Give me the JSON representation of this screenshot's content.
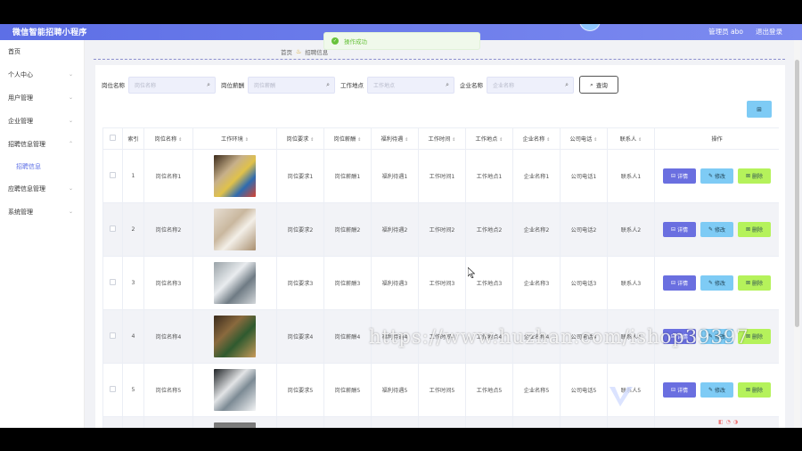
{
  "app": {
    "title": "微信智能招聘小程序"
  },
  "header": {
    "user_label": "管理员 abo",
    "logout_label": "退出登录"
  },
  "toast": {
    "message": "操作成功"
  },
  "sidebar": {
    "items": [
      {
        "label": "首页",
        "has_children": false
      },
      {
        "label": "个人中心",
        "has_children": true
      },
      {
        "label": "用户管理",
        "has_children": true
      },
      {
        "label": "企业管理",
        "has_children": true
      },
      {
        "label": "招聘信息管理",
        "has_children": true
      },
      {
        "label": "应聘信息管理",
        "has_children": true
      },
      {
        "label": "系统管理",
        "has_children": true
      }
    ],
    "sub_item": {
      "label": "招聘信息"
    }
  },
  "breadcrumb": {
    "home": "首页",
    "current": "招聘信息"
  },
  "search": {
    "fields": [
      {
        "label": "岗位名称",
        "placeholder": "岗位名称"
      },
      {
        "label": "岗位薪酬",
        "placeholder": "岗位薪酬"
      },
      {
        "label": "工作地点",
        "placeholder": "工作地点"
      },
      {
        "label": "企业名称",
        "placeholder": "企业名称"
      }
    ],
    "query_label": "查询"
  },
  "toolbar": {
    "add_label": "新增"
  },
  "table": {
    "headers": [
      "索引",
      "岗位名称",
      "工作环境",
      "岗位要求",
      "岗位薪酬",
      "福利待遇",
      "工作时间",
      "工作地点",
      "企业名称",
      "公司电话",
      "联系人",
      "操作"
    ],
    "rows": [
      {
        "index": "1",
        "name": "岗位名称1",
        "req": "岗位要求1",
        "salary": "岗位薪酬1",
        "welfare": "福利待遇1",
        "time": "工作时间1",
        "place": "工作地点1",
        "company": "企业名称1",
        "phone": "公司电话1",
        "contact": "联系人1"
      },
      {
        "index": "2",
        "name": "岗位名称2",
        "req": "岗位要求2",
        "salary": "岗位薪酬2",
        "welfare": "福利待遇2",
        "time": "工作时间2",
        "place": "工作地点2",
        "company": "企业名称2",
        "phone": "公司电话2",
        "contact": "联系人2"
      },
      {
        "index": "3",
        "name": "岗位名称3",
        "req": "岗位要求3",
        "salary": "岗位薪酬3",
        "welfare": "福利待遇3",
        "time": "工作时间3",
        "place": "工作地点3",
        "company": "企业名称3",
        "phone": "公司电话3",
        "contact": "联系人3"
      },
      {
        "index": "4",
        "name": "岗位名称4",
        "req": "岗位要求4",
        "salary": "岗位薪酬4",
        "welfare": "福利待遇4",
        "time": "工作时间4",
        "place": "工作地点4",
        "company": "企业名称4",
        "phone": "公司电话4",
        "contact": "联系人4"
      },
      {
        "index": "5",
        "name": "岗位名称5",
        "req": "岗位要求5",
        "salary": "岗位薪酬5",
        "welfare": "福利待遇5",
        "time": "工作时间5",
        "place": "工作地点5",
        "company": "企业名称5",
        "phone": "公司电话5",
        "contact": "联系人5"
      }
    ],
    "actions": {
      "detail": "详情",
      "edit": "修改",
      "delete": "删除"
    }
  },
  "watermark": {
    "text": "https://www.huzhan.com/ishop39397"
  },
  "colors": {
    "accent": "#5d6fe6",
    "detail": "#6a6fe0",
    "edit": "#7ecbf5",
    "delete": "#b5f25b",
    "success": "#67c23a"
  }
}
